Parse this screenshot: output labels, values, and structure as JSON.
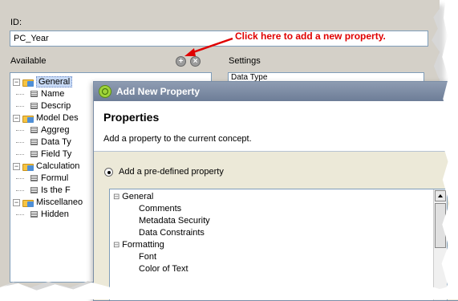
{
  "form": {
    "id_label": "ID:",
    "id_value": "PC_Year",
    "available_label": "Available",
    "settings_label": "Settings",
    "settings_value": "Data Type"
  },
  "callout": {
    "text": "Click here to add a new property.",
    "color": "#e00000"
  },
  "tree": [
    {
      "label": "General",
      "type": "folder",
      "selected": true
    },
    {
      "label": "Name",
      "type": "leaf"
    },
    {
      "label": "Descrip",
      "type": "leaf"
    },
    {
      "label": "Model Des",
      "type": "folder"
    },
    {
      "label": "Aggreg",
      "type": "leaf"
    },
    {
      "label": "Data Ty",
      "type": "leaf"
    },
    {
      "label": "Field Ty",
      "type": "leaf"
    },
    {
      "label": "Calculation",
      "type": "folder"
    },
    {
      "label": "Formul",
      "type": "leaf"
    },
    {
      "label": "Is the F",
      "type": "leaf"
    },
    {
      "label": "Miscellaneo",
      "type": "folder"
    },
    {
      "label": "Hidden",
      "type": "leaf"
    }
  ],
  "dialog": {
    "title": "Add New Property",
    "heading": "Properties",
    "description": "Add a property to the current concept.",
    "radio_label": "Add a pre-defined property",
    "list": [
      {
        "label": "General",
        "level": 0
      },
      {
        "label": "Comments",
        "level": 1
      },
      {
        "label": "Metadata Security",
        "level": 1
      },
      {
        "label": "Data Constraints",
        "level": 1
      },
      {
        "label": "Formatting",
        "level": 0
      },
      {
        "label": "Font",
        "level": 1
      },
      {
        "label": "Color of Text",
        "level": 1
      }
    ]
  },
  "icons": {
    "add": "add-property-icon",
    "remove": "remove-property-icon",
    "expander": "collapse-icon",
    "folder": "folder-icon",
    "leaf": "property-icon"
  }
}
